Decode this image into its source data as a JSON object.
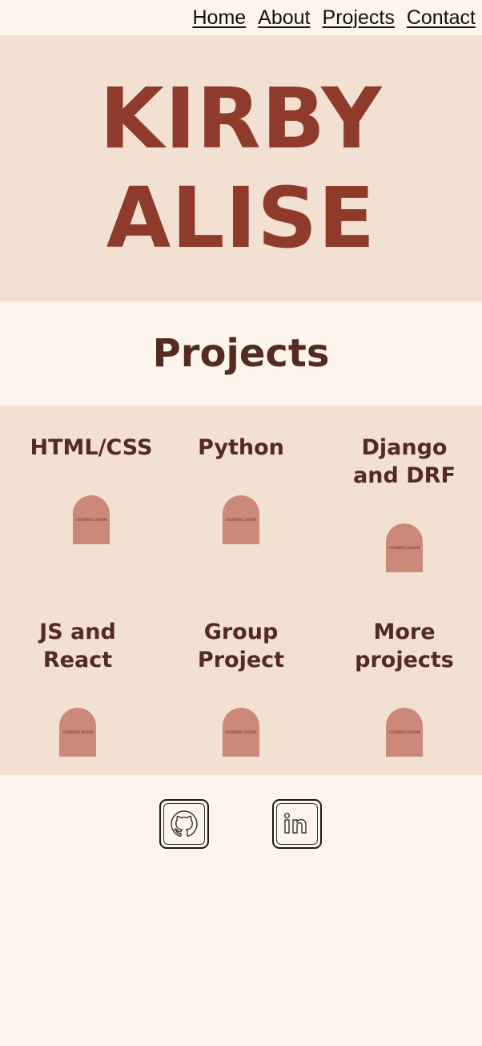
{
  "nav": {
    "items": [
      {
        "label": "Home"
      },
      {
        "label": "About"
      },
      {
        "label": "Projects"
      },
      {
        "label": "Contact"
      }
    ]
  },
  "hero": {
    "name_line1": "KIRBY",
    "name_line2": "ALISE"
  },
  "projects": {
    "heading": "Projects",
    "cards": [
      {
        "title_line1": "HTML/CSS",
        "title_line2": "",
        "badge": "COMING SOON"
      },
      {
        "title_line1": "Python",
        "title_line2": "",
        "badge": "COMING SOON"
      },
      {
        "title_line1": "Django",
        "title_line2": "and DRF",
        "badge": "COMING SOON"
      },
      {
        "title_line1": "JS and",
        "title_line2": "React",
        "badge": "COMING SOON"
      },
      {
        "title_line1": "Group",
        "title_line2": "Project",
        "badge": "COMING SOON"
      },
      {
        "title_line1": "More",
        "title_line2": "projects",
        "badge": "COMING SOON"
      }
    ]
  },
  "footer": {
    "links": [
      {
        "icon": "github-icon"
      },
      {
        "icon": "linkedin-icon"
      }
    ]
  },
  "colors": {
    "page_bg": "#fdf4ec",
    "section_bg": "#f2e0d2",
    "hero_text": "#8e3b2c",
    "heading_text": "#532b21",
    "arch": "#cc8878"
  }
}
